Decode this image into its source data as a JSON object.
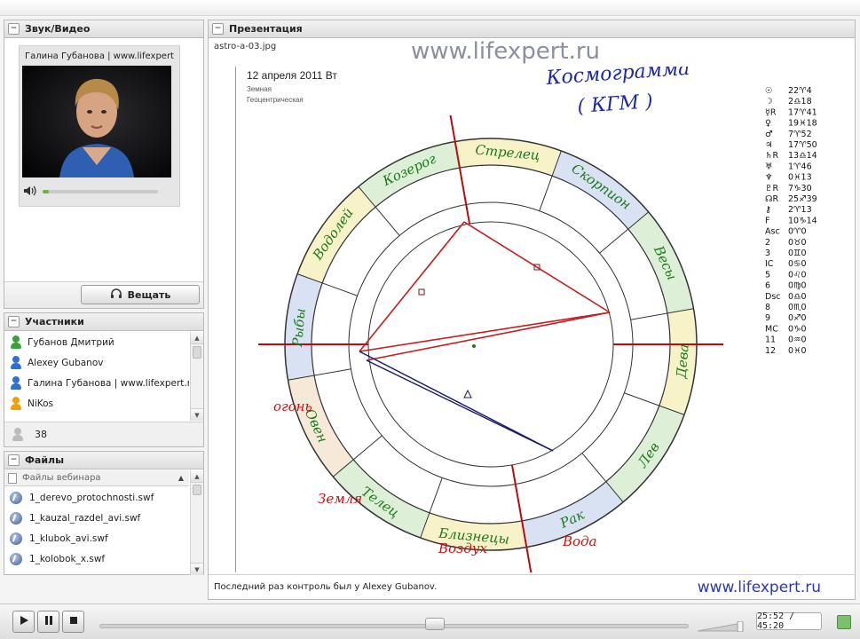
{
  "av": {
    "title": "Звук/Видео",
    "video_title": "Галина Губанова | www.lifexpert.ru",
    "volume": 0.05,
    "broadcast_label": "Вещать"
  },
  "participants": {
    "title": "Участники",
    "items": [
      {
        "name": "Губанов Дмитрий",
        "color": "#3aa23a"
      },
      {
        "name": "Alexey Gubanov",
        "color": "#2f6fd0"
      },
      {
        "name": "Галина Губанова | www.lifexpert.ru",
        "color": "#2f6fd0"
      },
      {
        "name": "NiKos",
        "color": "#f0a000"
      }
    ],
    "count": "38"
  },
  "files": {
    "title": "Файлы",
    "column_header": "Файлы вебинара",
    "items": [
      "1_derevo_protochnosti.swf",
      "1_kauzal_razdel_avi.swf",
      "1_klubok_avi.swf",
      "1_kolobok_x.swf"
    ]
  },
  "presentation": {
    "title": "Презентация",
    "file_name": "astro-a-03.jpg",
    "brand_top": "www.lifexpert.ru",
    "brand_bottom": "www.lifexpert.ru",
    "last_control": "Последний раз контроль был у Alexey Gubanov.",
    "slide": {
      "date": "12 апреля 2011  Вт",
      "sub1": "Земная",
      "sub2": "Геоцентрическая",
      "heading1": "Космограмма",
      "heading2": "( КГМ )",
      "signs": [
        "Козерог",
        "Стрелец",
        "Скорпион",
        "Весы",
        "Дева",
        "Лев",
        "Рак",
        "Близнецы",
        "Телец",
        "Овен",
        "Рыбы",
        "Водолей"
      ],
      "elements": {
        "fire": "огонь",
        "earth": "Земля",
        "air": "Воздух",
        "water": "Вода"
      },
      "planets": [
        {
          "sym": "☉",
          "pos": "22♈4"
        },
        {
          "sym": "☽",
          "pos": "2♎18"
        },
        {
          "sym": "☿R",
          "pos": "17♈41"
        },
        {
          "sym": "♀",
          "pos": "19♓18"
        },
        {
          "sym": "♂",
          "pos": "7♈52"
        },
        {
          "sym": "♃",
          "pos": "17♈50"
        },
        {
          "sym": "♄R",
          "pos": "13♎14"
        },
        {
          "sym": "♅",
          "pos": "1♈46"
        },
        {
          "sym": "♆",
          "pos": "0♓13"
        },
        {
          "sym": "♇R",
          "pos": "7♑30"
        },
        {
          "sym": "☊R",
          "pos": "25♐39"
        },
        {
          "sym": "⚷",
          "pos": "2♈13"
        },
        {
          "sym": "F",
          "pos": "10♑14"
        },
        {
          "sym": "Asc",
          "pos": "0♈0"
        },
        {
          "sym": "2",
          "pos": "0♉0"
        },
        {
          "sym": "3",
          "pos": "0♊0"
        },
        {
          "sym": "IC",
          "pos": "0♋0"
        },
        {
          "sym": "5",
          "pos": "0♌0"
        },
        {
          "sym": "6",
          "pos": "0♍0"
        },
        {
          "sym": "Dsc",
          "pos": "0♎0"
        },
        {
          "sym": "8",
          "pos": "0♏0"
        },
        {
          "sym": "9",
          "pos": "0♐0"
        },
        {
          "sym": "MC",
          "pos": "0♑0"
        },
        {
          "sym": "11",
          "pos": "0♒0"
        },
        {
          "sym": "12",
          "pos": "0♓0"
        }
      ]
    }
  },
  "player": {
    "time": "25:52 / 45:20",
    "progress": 0.57
  }
}
